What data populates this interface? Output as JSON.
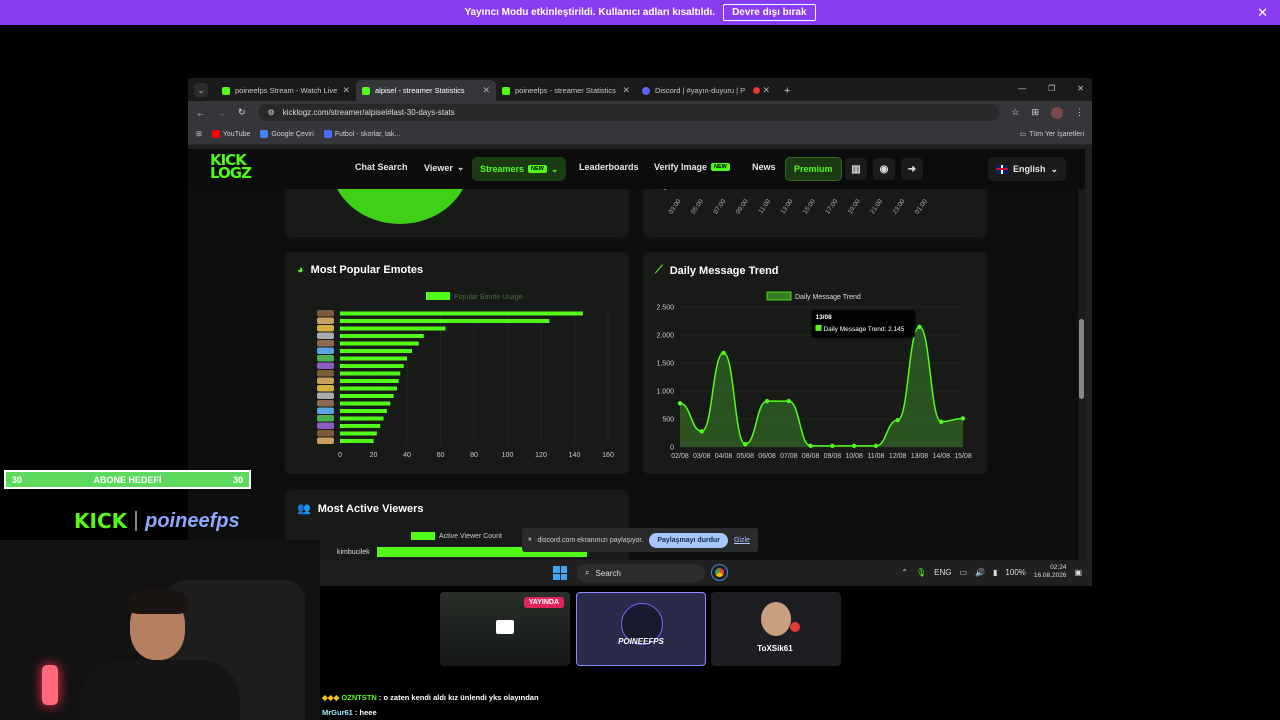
{
  "banner": {
    "text": "Yayıncı Modu etkinleştirildi. Kullanıcı adları kısaltıldı.",
    "button": "Devre dışı bırak",
    "close": "✕"
  },
  "browser": {
    "tabs": [
      {
        "title": "poineefps Stream - Watch Live",
        "color": "#53fc18"
      },
      {
        "title": "alpisel - streamer Statistics",
        "color": "#53fc18"
      },
      {
        "title": "poineefps - streamer Statistics",
        "color": "#53fc18"
      },
      {
        "title": "Discord | #yayın-duyuru | P",
        "color": "#5865f2"
      }
    ],
    "url": "kicklogz.com/streamer/alpisel#last-30-days-stats",
    "bookmarks": [
      {
        "label": "YouTube",
        "color": "#ff0000"
      },
      {
        "label": "Google Çeviri",
        "color": "#4285f4"
      },
      {
        "label": "Futbol - skorlar, tak...",
        "color": "#4a6cf7"
      }
    ],
    "all_bookmarks": "Tüm Yer İşaretleri"
  },
  "site": {
    "logo_top": "KICK",
    "logo_bottom": "LOGZ",
    "nav": {
      "chat_search": "Chat Search",
      "viewer": "Viewer",
      "streamers": "Streamers",
      "new": "NEW",
      "leaderboards": "Leaderboards",
      "verify_image": "Verify Image",
      "news": "News",
      "premium": "Premium"
    },
    "language": "English",
    "top_chart_ticks": [
      "03:00",
      "05:00",
      "07:00",
      "09:00",
      "11:00",
      "13:00",
      "15:00",
      "17:00",
      "19:00",
      "21:00",
      "23:00",
      "01:00"
    ],
    "top_chart_zero": "0"
  },
  "chart_data": [
    {
      "type": "bar",
      "title": "Most Popular Emotes",
      "legend": "Popular Emote Usage",
      "orientation": "horizontal",
      "values": [
        145,
        125,
        63,
        50,
        47,
        43,
        40,
        38,
        36,
        35,
        34,
        32,
        30,
        28,
        26,
        24,
        22,
        20
      ],
      "xticks": [
        "0",
        "20",
        "40",
        "60",
        "80",
        "100",
        "120",
        "140",
        "160"
      ],
      "xlim": [
        0,
        160
      ],
      "color": "#53fc18"
    },
    {
      "type": "area",
      "title": "Daily Message Trend",
      "legend": "Daily Message Trend",
      "categories": [
        "02/08",
        "03/08",
        "04/08",
        "05/08",
        "06/08",
        "07/08",
        "08/08",
        "09/08",
        "10/08",
        "11/08",
        "12/08",
        "13/08",
        "14/08",
        "15/08"
      ],
      "values": [
        780,
        280,
        1680,
        50,
        820,
        820,
        20,
        20,
        20,
        20,
        480,
        2145,
        450,
        510
      ],
      "yticks": [
        "2.500",
        "2.000",
        "1.500",
        "1.000",
        "500",
        "0"
      ],
      "ylim": [
        0,
        2500
      ],
      "tooltip": {
        "date": "13/08",
        "text": "Daily Message Trend: 2.145"
      },
      "color": "#53fc18"
    }
  ],
  "active_viewers": {
    "title": "Most Active Viewers",
    "legend": "Active Viewer Count",
    "first_name": "kimbucilek"
  },
  "sharebar": {
    "text": "discord.com ekranınızı paylaşıyor.",
    "stop": "Paylaşmayı durdur",
    "hide": "Gizle"
  },
  "taskbar": {
    "search": "Search",
    "lang": "ENG",
    "battery": "100%",
    "time": "02:24",
    "date": "16.08.2026"
  },
  "overlay": {
    "goal_left": "30",
    "goal_label": "ABONE HEDEFİ",
    "goal_right": "30",
    "brand_kick": "KICK",
    "brand_name": "poineefps",
    "live_badge": "YAYINDA",
    "tile_name": "POINEEFPS",
    "tile_user": "ToXSik61",
    "chat": [
      {
        "user": "OZNTSTN",
        "msg": "o zaten kendi aldı kız ünlendi yks olayından"
      },
      {
        "user": "MrGur61",
        "msg": "heee"
      }
    ]
  }
}
